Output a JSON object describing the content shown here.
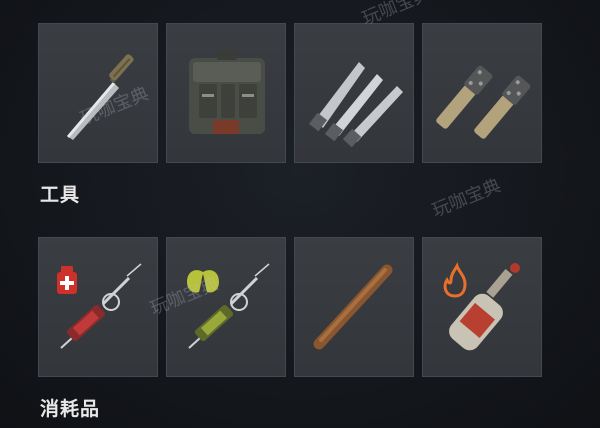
{
  "sections": [
    {
      "label": "工具",
      "items": [
        {
          "icon": "knife-icon"
        },
        {
          "icon": "backpack-icon"
        },
        {
          "icon": "throwing-knives-icon"
        },
        {
          "icon": "stun-batons-icon"
        }
      ]
    },
    {
      "label": "消耗品",
      "items": [
        {
          "icon": "health-syringe-icon",
          "badge_icon": "medkit-icon"
        },
        {
          "icon": "stamina-syringe-icon",
          "badge_icon": "lungs-icon"
        },
        {
          "icon": "cigar-icon"
        },
        {
          "icon": "molotov-cocktail-icon",
          "badge_icon": "fire-icon"
        }
      ]
    }
  ],
  "watermark": "玩咖宝典",
  "colors": {
    "background": "#14171c",
    "slot": "#37393e",
    "label": "#e8e8e8",
    "medkit": "#d0302a",
    "lungs": "#b7c23a",
    "fire": "#e8702a"
  }
}
